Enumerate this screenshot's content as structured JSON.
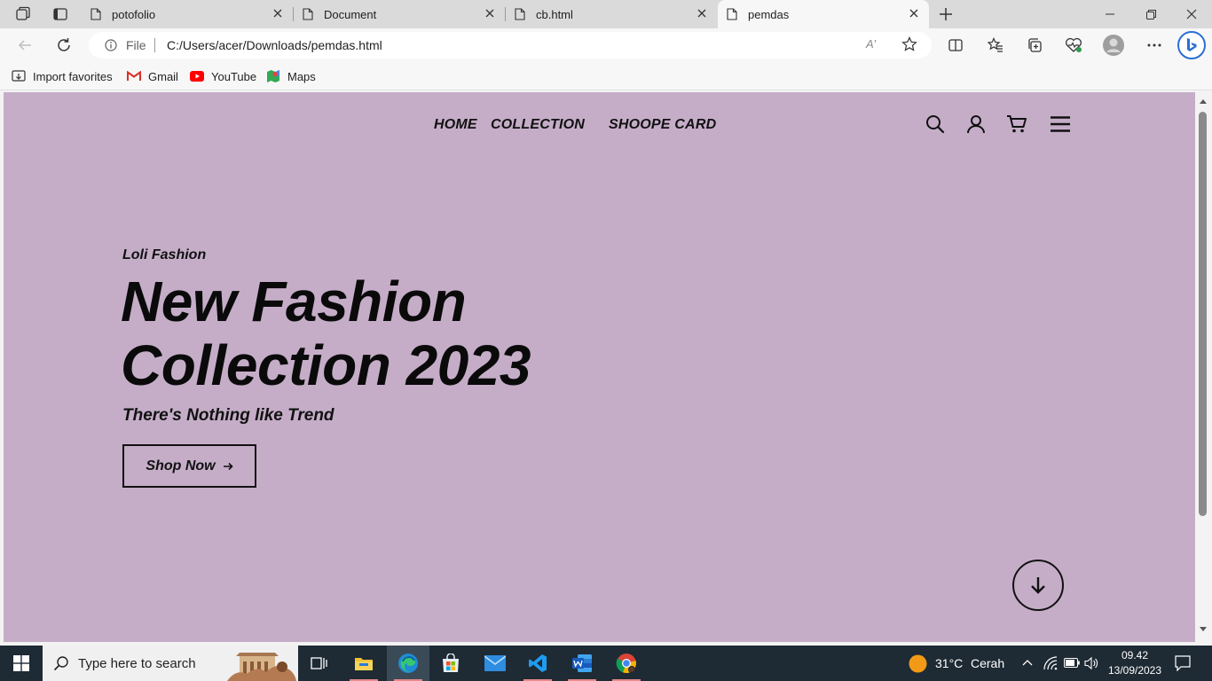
{
  "browser": {
    "tabs": [
      {
        "title": "potofolio"
      },
      {
        "title": "Document"
      },
      {
        "title": "cb.html"
      },
      {
        "title": "pemdas",
        "active": true
      }
    ],
    "address": {
      "scheme_label": "File",
      "url": "C:/Users/acer/Downloads/pemdas.html",
      "read_aloud_label": "A’"
    },
    "favorites": [
      {
        "label": "Import favorites",
        "icon": "import-icon"
      },
      {
        "label": "Gmail",
        "icon": "gmail-icon"
      },
      {
        "label": "YouTube",
        "icon": "youtube-icon"
      },
      {
        "label": "Maps",
        "icon": "maps-icon"
      }
    ]
  },
  "page": {
    "nav": {
      "links": [
        "HOME",
        "COLLECTION",
        "SHOOPE CARD"
      ],
      "icons": [
        "search-icon",
        "user-icon",
        "cart-icon",
        "menu-icon"
      ]
    },
    "hero": {
      "eyebrow": "Loli Fashion",
      "headline_line1": "New Fashion",
      "headline_line2": "Collection 2023",
      "tagline": "There's Nothing like Trend",
      "cta_label": "Shop Now",
      "cta_icon": "arrow-right-icon"
    },
    "scroll_icon": "arrow-down-icon",
    "background_color": "#c5adc8"
  },
  "taskbar": {
    "search_placeholder": "Type here to search",
    "apps": [
      "task-view-icon",
      "file-explorer-icon",
      "edge-icon",
      "store-icon",
      "mail-icon",
      "vscode-icon",
      "word-icon",
      "chrome-icon"
    ],
    "weather": {
      "temp": "31°C",
      "condition": "Cerah"
    },
    "time": "09.42",
    "date": "13/09/2023"
  }
}
